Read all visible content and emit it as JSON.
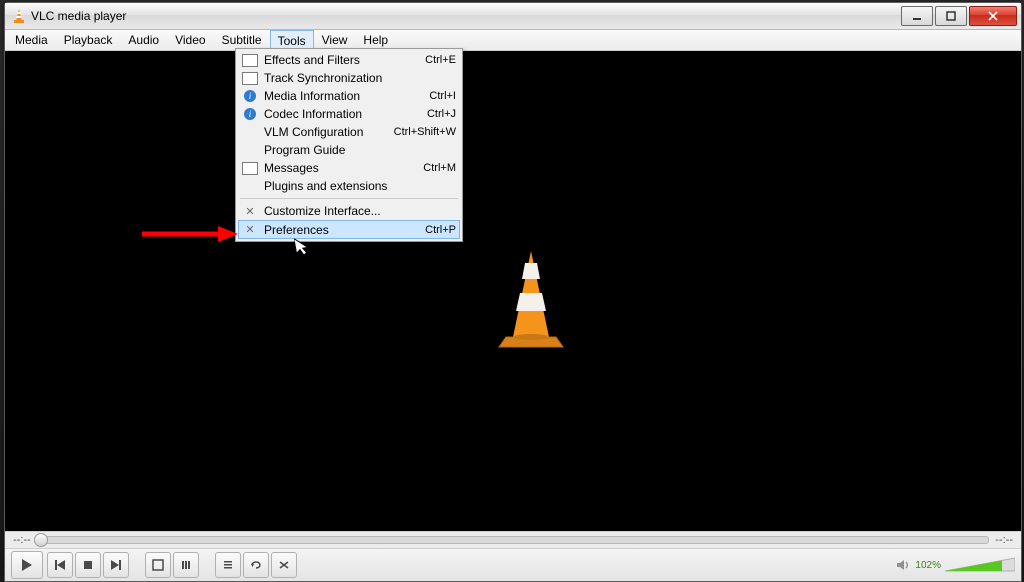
{
  "window": {
    "title": "VLC media player"
  },
  "menubar": {
    "items": [
      "Media",
      "Playback",
      "Audio",
      "Video",
      "Subtitle",
      "Tools",
      "View",
      "Help"
    ],
    "open_index": 5
  },
  "tools_menu": {
    "items": [
      {
        "icon": "adjust",
        "label": "Effects and Filters",
        "shortcut": "Ctrl+E"
      },
      {
        "icon": "sync",
        "label": "Track Synchronization",
        "shortcut": ""
      },
      {
        "icon": "info",
        "label": "Media Information",
        "shortcut": "Ctrl+I"
      },
      {
        "icon": "info",
        "label": "Codec Information",
        "shortcut": "Ctrl+J"
      },
      {
        "icon": "",
        "label": "VLM Configuration",
        "shortcut": "Ctrl+Shift+W"
      },
      {
        "icon": "",
        "label": "Program Guide",
        "shortcut": ""
      },
      {
        "icon": "msg",
        "label": "Messages",
        "shortcut": "Ctrl+M"
      },
      {
        "icon": "",
        "label": "Plugins and extensions",
        "shortcut": ""
      }
    ],
    "items2": [
      {
        "icon": "tools",
        "label": "Customize Interface...",
        "shortcut": ""
      },
      {
        "icon": "tools",
        "label": "Preferences",
        "shortcut": "Ctrl+P"
      }
    ],
    "highlight_index2": 1
  },
  "seek": {
    "elapsed": "--:--",
    "total": "--:--"
  },
  "volume": {
    "percent": "102%"
  }
}
